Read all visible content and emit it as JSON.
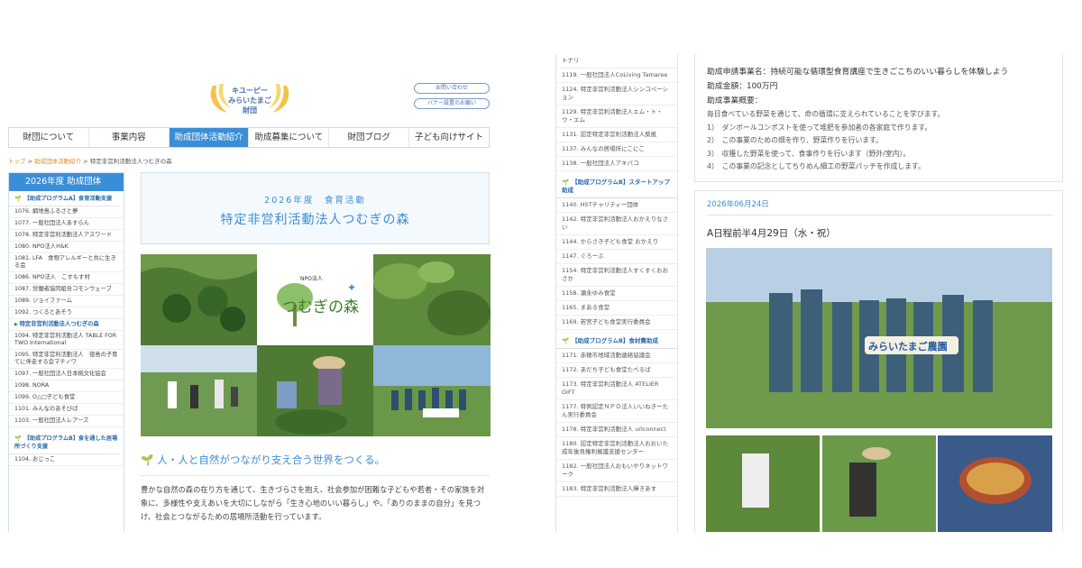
{
  "left": {
    "logo": {
      "line1": "キユーピー",
      "line2": "みらいたまご",
      "line3": "財団"
    },
    "header_buttons": [
      "お問い合わせ",
      "バナー設置のお願い"
    ],
    "nav": [
      "財団について",
      "事業内容",
      "助成団体活動紹介",
      "助成募集について",
      "財団ブログ",
      "子ども向けサイト"
    ],
    "breadcrumb": {
      "home": "トップ",
      "sep": " > ",
      "section": "助成団体活動紹介",
      "current": "特定非営利活動法人つむぎの森"
    },
    "sidebar": {
      "heading": "2026年度 助成団体",
      "program_a": "【助成プログラムA】食育活動支援",
      "items_a": [
        "1076. 網地島ふるさと夢",
        "1077. 一般社団法人あすらん",
        "1078. 特定非営利活動法人アスワード",
        "1080. NPO法人H&K",
        "1081. LFA　食物アレルギーと共に生きる会",
        "1086. NPO法人　こすもす村",
        "1087. 労働者協同組合コモンウェーブ",
        "1089. ジョイファーム",
        "1092. つくるとあそう",
        "特定非営利活動法人つむぎの森",
        "1094. 特定非営利活動法人 TABLE FOR TWO International",
        "1095. 特定非営利活動法人　徳島の子育てに伴走する会マチノワ",
        "1097. 一般社団法人日本桃文化協会",
        "1098. NORA",
        "1099. O△□子ども食堂",
        "1101. みんなのあそびば",
        "1103. 一般社団法人レアーズ"
      ],
      "program_b": "【助成プログラムB】食を通した居場所づくり支援",
      "items_b": [
        "1104. おじっこ"
      ]
    },
    "title_year": "2026年度　食育活動",
    "title_name": "特定非営利活動法人つむぎの森",
    "center_logo": {
      "small": "NPO法人",
      "main": "つむぎの森"
    },
    "tagline": "人・人と自然がつながり支え合う世界をつくる。",
    "description": "豊かな自然の森の在り方を通じて、生きづらさを抱え、社会参加が困難な子どもや若者・その家族を対象に、多様性や支えあいを大切にしながら「生き心地のいい暮らし」や、「ありのままの自分」を見つけ、社会とつながるための居場所活動を行っています。"
  },
  "right": {
    "sidebar": {
      "items_top": [
        "トナリ",
        "1119. 一般社団法人CoLiving Tamaree",
        "1124. 特定非営利活動法人シンコペーション",
        "1129. 特定非営利活動法人エム・ト・ウ・エム",
        "1131. 認定特定非営利活動法人葵風",
        "1137. みんなの居場所にこにこ",
        "1138. 一般社団法人アキパコ"
      ],
      "program_b": "【助成プログラムB】スタートアップ助成",
      "items_b": [
        "1140. HSTチャリティー団体",
        "1142. 特定非営利活動法人おかえりなさい",
        "1144. からさき子ども食堂 おかえり",
        "1147. ぐろーぶ",
        "1154. 特定非営利活動法人すくすくおおさか",
        "1158. 瀬永ゆみ食堂",
        "1165. まある食堂",
        "1169. 若宮子ども食堂実行委員会"
      ],
      "program_b2": "【助成プログラムB】食材費助成",
      "items_b2": [
        "1171. 赤穂市地域活動連絡協議会",
        "1172. あだち子ども食堂たべるば",
        "1173. 特定非営利活動法人 ATELIER GIFT",
        "1177. 特例認定ＮＰＯ法人いいねきーたん実行委員会",
        "1178. 特定非営利活動法人 urlconnect",
        "1180. 認定特定非営利活動法人おおいた成年後見権利擁護支援センター",
        "1182. 一般社団法人おもいやりネットワーク",
        "1183. 特定非営利活動法人輝きあす"
      ]
    },
    "summary": {
      "project": "助成申請事業名：持続可能な循環型食育講座で生きごこちのいい暮らしを体験しよう",
      "amount": "助成金額：100万円",
      "overview_label": "助成事業概要：",
      "overview_intro": "毎日食べている野菜を通じて、命の循環に支えられていることを学びます。",
      "steps": [
        "1）　ダンボールコンポストを使って堆肥を参加者の各家庭で作ります。",
        "2）　この事業のための畑を作り、野菜作りを行います。",
        "3）　収穫した野菜を使って、食事作りを行います（野外/室内）。",
        "4）　この事業の記念としてちりめん細工の野菜パッチを作成します。"
      ]
    },
    "post": {
      "date": "2026年06月24日",
      "title": "A日程前半4月29日（水・祝）",
      "banner_text": "みらいたまご農園"
    }
  },
  "colors": {
    "accent": "#3a8ed8",
    "link_orange": "#e08a2e",
    "leaf_green": "#5aa03a"
  }
}
